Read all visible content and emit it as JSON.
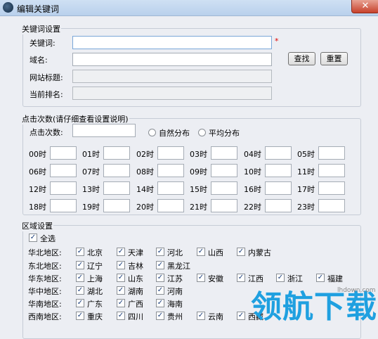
{
  "window": {
    "title": "编辑关键词",
    "close_glyph": "✕"
  },
  "keyword_settings": {
    "group_title": "关键词设置",
    "keyword_label": "关键词:",
    "keyword_value": "",
    "required_mark": "*",
    "domain_label": "域名:",
    "domain_value": "",
    "search_button": "查找",
    "reset_button": "重置",
    "site_title_label": "网站标题:",
    "current_rank_label": "当前排名:"
  },
  "click_settings": {
    "group_title": "点击次数(请仔细查看设置说明)",
    "clicks_label": "点击次数:",
    "clicks_value": "",
    "natural_distribution": "自然分布",
    "average_distribution": "平均分布",
    "hours": [
      "00时",
      "01时",
      "02时",
      "03时",
      "04时",
      "05时",
      "06时",
      "07时",
      "08时",
      "09时",
      "10时",
      "11时",
      "12时",
      "13时",
      "14时",
      "15时",
      "16时",
      "17时",
      "18时",
      "19时",
      "20时",
      "21时",
      "22时",
      "23时"
    ]
  },
  "region_settings": {
    "group_title": "区域设置",
    "select_all": "全选",
    "rows": [
      {
        "region": "华北地区:",
        "provinces": [
          "北京",
          "天津",
          "河北",
          "山西",
          "内蒙古"
        ]
      },
      {
        "region": "东北地区:",
        "provinces": [
          "辽宁",
          "吉林",
          "黑龙江"
        ]
      },
      {
        "region": "华东地区:",
        "provinces": [
          "上海",
          "山东",
          "江苏",
          "安徽",
          "江西",
          "浙江",
          "福建"
        ]
      },
      {
        "region": "华中地区:",
        "provinces": [
          "湖北",
          "湖南",
          "河南"
        ]
      },
      {
        "region": "华南地区:",
        "provinces": [
          "广东",
          "广西",
          "海南"
        ]
      },
      {
        "region": "西南地区:",
        "provinces": [
          "重庆",
          "四川",
          "贵州",
          "云南",
          "西藏"
        ]
      }
    ],
    "checkmark": "✓"
  },
  "watermark": {
    "text": "领航下载",
    "url": "lhdown.com"
  },
  "colors": {
    "accent": "#1fa0e0",
    "required": "#e00000"
  }
}
